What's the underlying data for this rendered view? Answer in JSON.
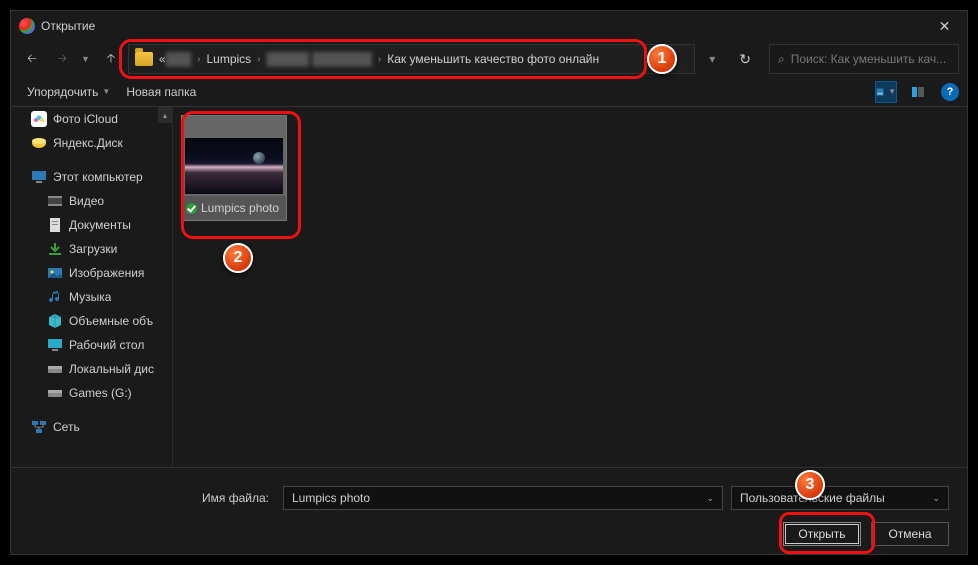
{
  "title": "Открытие",
  "breadcrumbs": {
    "lead": "«",
    "dim1": "███",
    "mid": "Lumpics",
    "dim2": "█████   ███████",
    "last": "Как уменьшить качество фото онлайн"
  },
  "search": {
    "placeholder": "Поиск: Как уменьшить кач..."
  },
  "toolbar": {
    "organize": "Упорядочить",
    "newfolder": "Новая папка"
  },
  "badges": {
    "b1": "1",
    "b2": "2",
    "b3": "3"
  },
  "sidebar": [
    {
      "label": "Фото iCloud",
      "icon": "icloud",
      "ind": false
    },
    {
      "label": "Яндекс.Диск",
      "icon": "yadisk",
      "ind": false
    },
    {
      "label": "",
      "icon": "",
      "ind": false,
      "spacer": true
    },
    {
      "label": "Этот компьютер",
      "icon": "pc",
      "ind": false
    },
    {
      "label": "Видео",
      "icon": "video",
      "ind": true
    },
    {
      "label": "Документы",
      "icon": "docs",
      "ind": true
    },
    {
      "label": "Загрузки",
      "icon": "down",
      "ind": true
    },
    {
      "label": "Изображения",
      "icon": "img",
      "ind": true
    },
    {
      "label": "Музыка",
      "icon": "music",
      "ind": true
    },
    {
      "label": "Объемные объ",
      "icon": "3d",
      "ind": true
    },
    {
      "label": "Рабочий стол",
      "icon": "desk",
      "ind": true
    },
    {
      "label": "Локальный дис",
      "icon": "hdd",
      "ind": true
    },
    {
      "label": "Games (G:)",
      "icon": "hdd",
      "ind": true
    },
    {
      "label": "",
      "icon": "",
      "ind": false,
      "spacer": true
    },
    {
      "label": "Сеть",
      "icon": "net",
      "ind": false
    }
  ],
  "file": {
    "name": "Lumpics photo"
  },
  "bottom": {
    "label": "Имя файла:",
    "value": "Lumpics photo",
    "filter": "Пользовательские файлы",
    "open": "Открыть",
    "cancel": "Отмена"
  }
}
